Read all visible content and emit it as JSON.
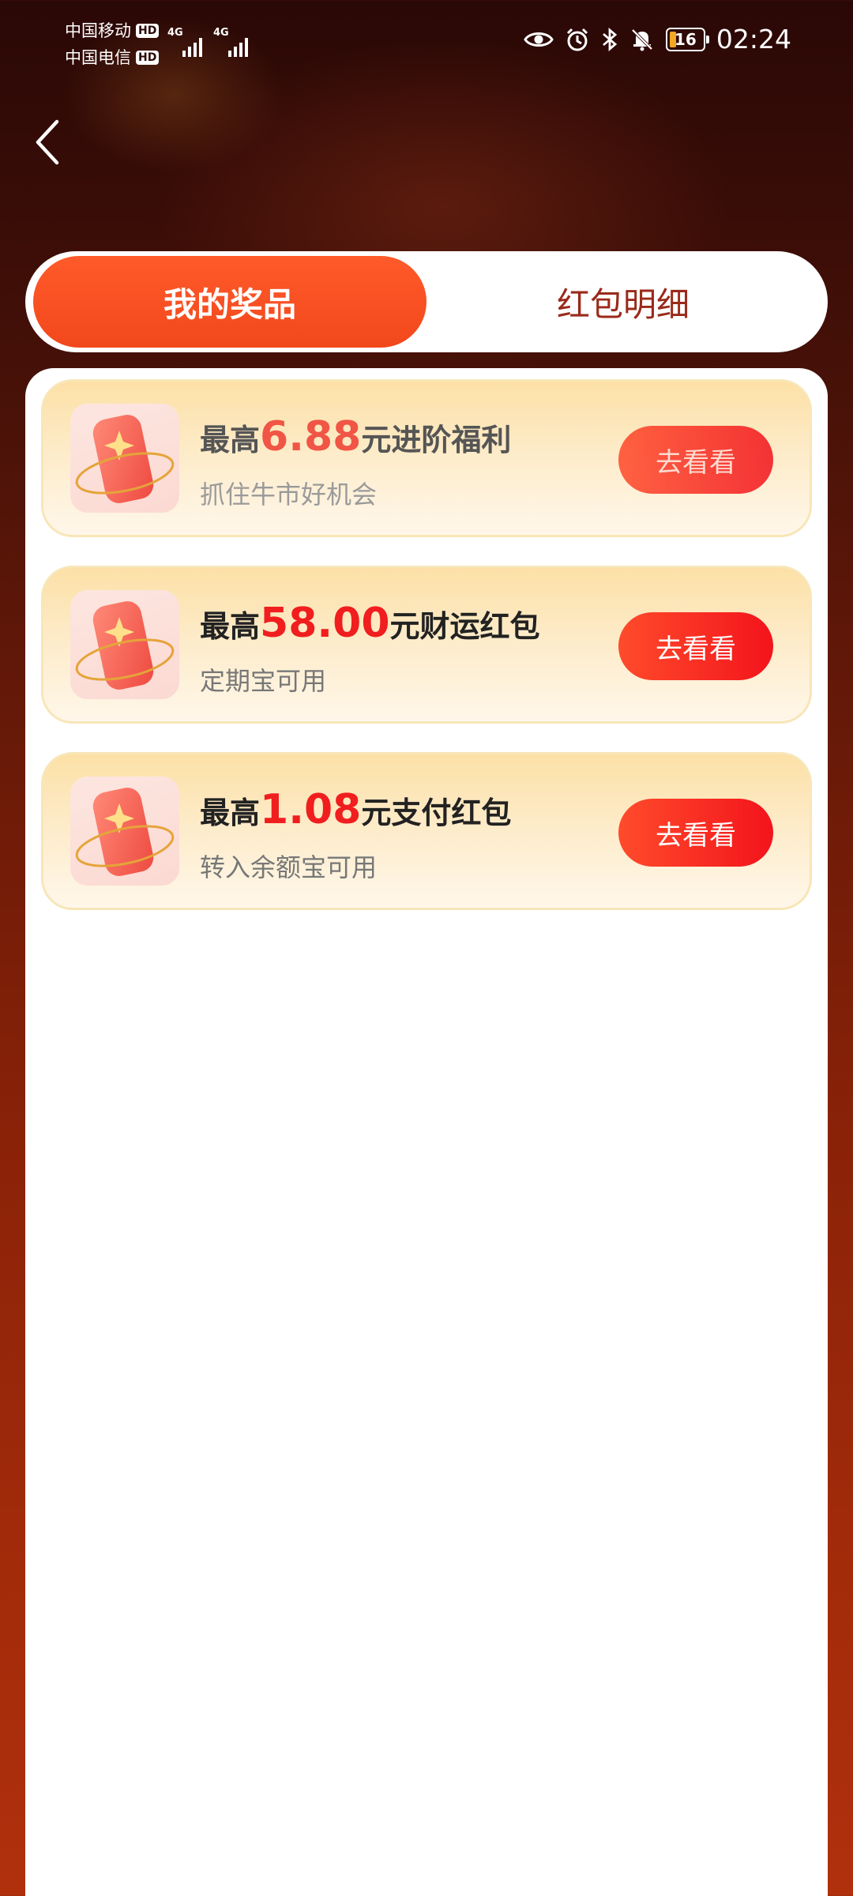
{
  "status_bar": {
    "carrier1": "中国移动",
    "carrier2": "中国电信",
    "hd": "HD",
    "network1": "4G",
    "network2": "4G",
    "battery_level": "16",
    "time": "02:24"
  },
  "tabs": [
    {
      "label": "我的奖品",
      "active": true
    },
    {
      "label": "红包明细",
      "active": false
    }
  ],
  "prize_cards": [
    {
      "prefix": "最高",
      "amount": "6.88",
      "suffix": "元进阶福利",
      "subtitle": "抓住牛市好机会",
      "button": "去看看",
      "icon": "red-envelope-icon"
    },
    {
      "prefix": "最高",
      "amount": "58.00",
      "suffix": "元财运红包",
      "subtitle": "定期宝可用",
      "button": "去看看",
      "icon": "red-envelope-icon"
    },
    {
      "prefix": "最高",
      "amount": "1.08",
      "suffix": "元支付红包",
      "subtitle": "转入余额宝可用",
      "button": "去看看",
      "icon": "red-envelope-icon"
    }
  ],
  "colors": {
    "accent": "#f2481c",
    "amount": "#f01e1e",
    "inactive_tab": "#9a2a1a"
  }
}
